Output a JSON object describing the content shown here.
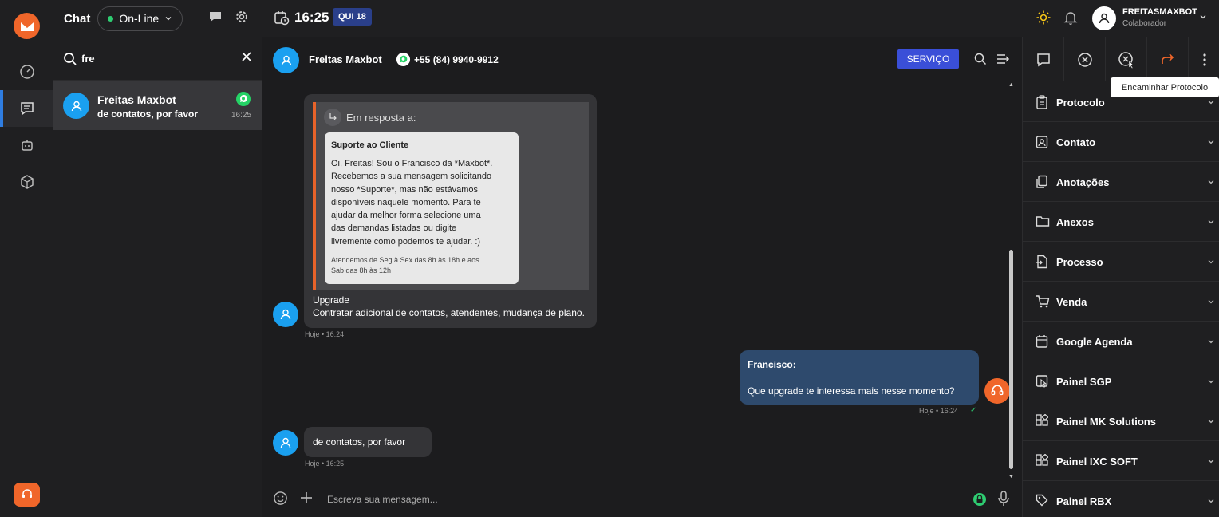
{
  "rail": {
    "items": [
      "logo",
      "dashboard",
      "chat",
      "bot",
      "package",
      "support"
    ]
  },
  "list": {
    "title": "Chat",
    "status": "On-Line",
    "search_value": "fre",
    "conversations": [
      {
        "name": "Freitas Maxbot",
        "last_message": "de contatos, por favor",
        "time": "16:25",
        "channel_icon": "whatsapp-icon"
      }
    ]
  },
  "topbar": {
    "time": "16:25",
    "day": "QUI 18",
    "user_name": "FREITASMAXBOT",
    "user_role": "Colaborador"
  },
  "chat": {
    "contact_name": "Freitas Maxbot",
    "phone": "+55 (84) 9940-9912",
    "service_button": "SERVIÇO",
    "composer_placeholder": "Escreva sua mensagem...",
    "messages": [
      {
        "direction": "in",
        "reply_label": "Em resposta a:",
        "quote_title": "Suporte ao Cliente",
        "quote_lines": [
          "Oi, Freitas! Sou o Francisco da *Maxbot*.",
          "Recebemos a sua mensagem solicitando",
          "nosso *Suporte*, mas não estávamos",
          "disponíveis naquele momento. Para te",
          "ajudar da melhor forma selecione uma",
          "das demandas listadas ou digite",
          "livremente como podemos te ajudar. :)"
        ],
        "quote_footer_lines": [
          "Atendemos de Seg à Sex das 8h às 18h e aos",
          "Sab das 8h às 12h"
        ],
        "title": "Upgrade",
        "text": "Contratar adicional de contatos, atendentes, mudança de plano.",
        "meta": "Hoje • 16:24"
      },
      {
        "direction": "out",
        "sender": "Francisco:",
        "text": "Que upgrade te interessa mais nesse momento?",
        "meta": "Hoje • 16:24",
        "status": "✓"
      },
      {
        "direction": "in",
        "text": "de contatos, por favor",
        "meta": "Hoje • 16:25"
      }
    ]
  },
  "right_panel": {
    "tooltip": "Encaminhar Protocolo",
    "tools": [
      "message-icon",
      "close-circle-icon",
      "cancel-cursor-icon",
      "forward-icon",
      "more-icon"
    ],
    "sections": [
      "Protocolo",
      "Contato",
      "Anotações",
      "Anexos",
      "Processo",
      "Venda",
      "Google Agenda",
      "Painel SGP",
      "Painel MK Solutions",
      "Painel IXC SOFT",
      "Painel RBX"
    ]
  },
  "colors": {
    "accent_orange": "#f0662a",
    "accent_blue": "#2f7de1",
    "service_button": "#3a4fd8",
    "outgoing_bubble": "#2e4a6d",
    "online_green": "#2ecc71"
  }
}
